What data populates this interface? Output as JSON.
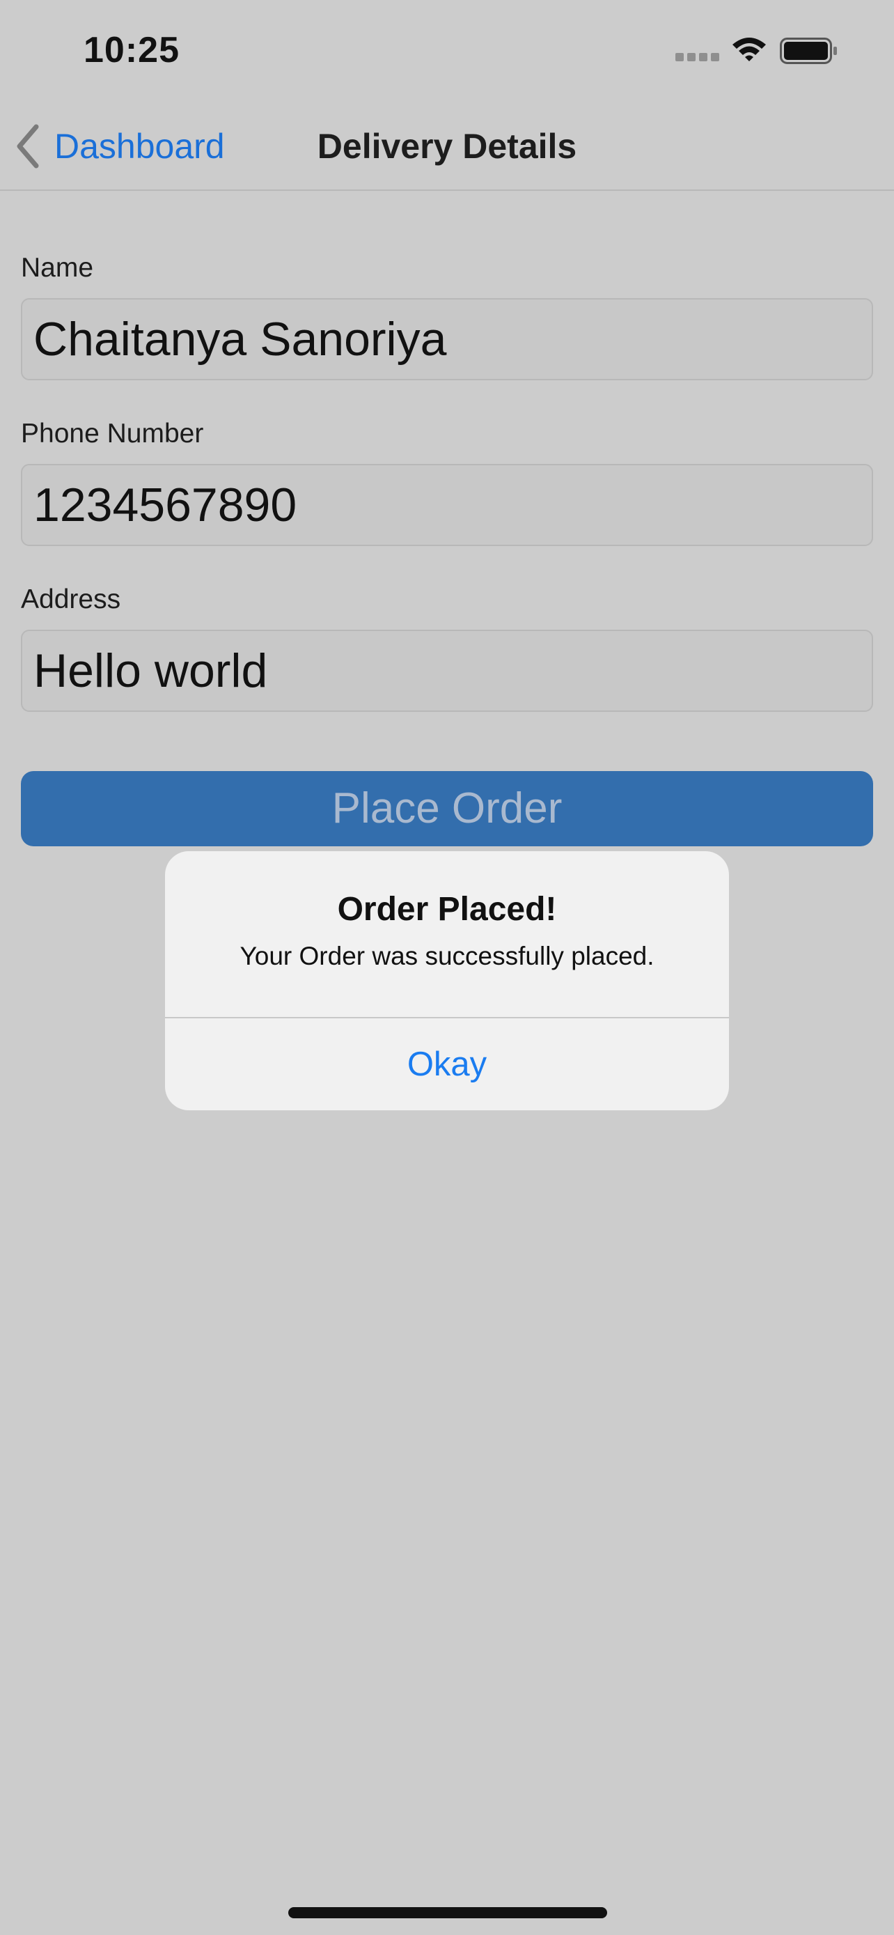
{
  "status_bar": {
    "time": "10:25",
    "icons": [
      "signal-icon",
      "wifi-icon",
      "battery-icon"
    ]
  },
  "nav": {
    "back_label": "Dashboard",
    "title": "Delivery Details",
    "back_icon": "chevron-left-icon"
  },
  "form": {
    "name": {
      "label": "Name",
      "value": "Chaitanya Sanoriya"
    },
    "phone": {
      "label": "Phone Number",
      "value": "1234567890"
    },
    "address": {
      "label": "Address",
      "value": "Hello world"
    },
    "submit_label": "Place Order"
  },
  "alert": {
    "title": "Order Placed!",
    "message": "Your Order was successfully placed.",
    "button_label": "Okay"
  },
  "colors": {
    "background": "#cccccc",
    "accent": "#1a6fd8",
    "button": "#336ead",
    "alert_bg": "#f1f1f1"
  }
}
